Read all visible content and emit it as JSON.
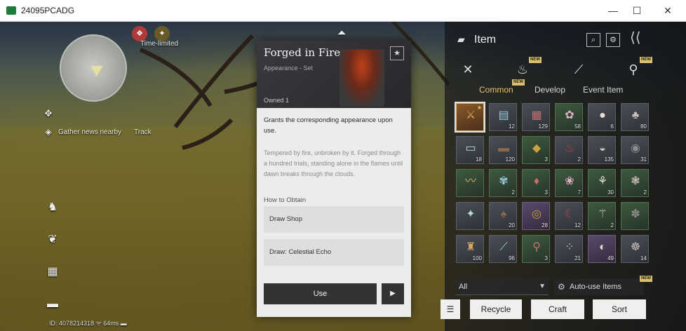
{
  "window": {
    "title": "24095PCADG",
    "min": "—",
    "max": "☐",
    "close": "✕"
  },
  "hud": {
    "time_limited": "Time-limited",
    "gather": "Gather news nearby",
    "track": "Track",
    "status": "ID: 4078214318  ᯤ 64ms ▬"
  },
  "card": {
    "title": "Forged in Fire",
    "subtitle": "Appearance - Set",
    "fav_icon": "star-icon",
    "owned": "Owned 1",
    "description": "Grants the corresponding appearance upon use.",
    "flavor": "Tempered by fire, unbroken by it. Forged through a hundred trials, standing alone in the flames until dawn breaks through the clouds.",
    "how_to_obtain": "How to Obtain",
    "obtain": [
      "Draw Shop",
      "Draw: Celestial Echo"
    ],
    "use": "Use",
    "next": "▶"
  },
  "inventory": {
    "title": "Item",
    "new_tag": "NEW",
    "tabs": [
      "Common",
      "Develop",
      "Event Item"
    ],
    "active_tab": "Common",
    "filter_all": "All",
    "auto_use": "Auto-use Items",
    "buttons": {
      "recycle": "Recycle",
      "craft": "Craft",
      "sort": "Sort"
    },
    "items": [
      {
        "icon": "⚔",
        "count": "",
        "rarity": "orange"
      },
      {
        "icon": "▤",
        "count": "12",
        "rarity": "normal"
      },
      {
        "icon": "▦",
        "count": "129",
        "rarity": "normal"
      },
      {
        "icon": "✿",
        "count": "58",
        "rarity": "green"
      },
      {
        "icon": "●",
        "count": "6",
        "rarity": "normal"
      },
      {
        "icon": "♣",
        "count": "80",
        "rarity": "normal"
      },
      {
        "icon": "▭",
        "count": "18",
        "rarity": "normal"
      },
      {
        "icon": "▬",
        "count": "120",
        "rarity": "normal"
      },
      {
        "icon": "◆",
        "count": "3",
        "rarity": "green"
      },
      {
        "icon": "♨",
        "count": "2",
        "rarity": "normal"
      },
      {
        "icon": "◒",
        "count": "135",
        "rarity": "normal"
      },
      {
        "icon": "◉",
        "count": "31",
        "rarity": "normal"
      },
      {
        "icon": "〰",
        "count": "",
        "rarity": "green"
      },
      {
        "icon": "✾",
        "count": "2",
        "rarity": "green"
      },
      {
        "icon": "♦",
        "count": "3",
        "rarity": "green"
      },
      {
        "icon": "❀",
        "count": "7",
        "rarity": "green"
      },
      {
        "icon": "⚘",
        "count": "30",
        "rarity": "green"
      },
      {
        "icon": "❃",
        "count": "2",
        "rarity": "green"
      },
      {
        "icon": "✦",
        "count": "",
        "rarity": "normal"
      },
      {
        "icon": "♠",
        "count": "20",
        "rarity": "normal"
      },
      {
        "icon": "◎",
        "count": "28",
        "rarity": "purple"
      },
      {
        "icon": "☾",
        "count": "12",
        "rarity": "normal"
      },
      {
        "icon": "⚚",
        "count": "2",
        "rarity": "green"
      },
      {
        "icon": "✽",
        "count": "",
        "rarity": "green"
      },
      {
        "icon": "♜",
        "count": "100",
        "rarity": "normal"
      },
      {
        "icon": "⟋",
        "count": "96",
        "rarity": "normal"
      },
      {
        "icon": "⚲",
        "count": "3",
        "rarity": "green"
      },
      {
        "icon": "⁘",
        "count": "21",
        "rarity": "normal"
      },
      {
        "icon": "◐",
        "count": "49",
        "rarity": "purple"
      },
      {
        "icon": "☸",
        "count": "14",
        "rarity": "normal"
      }
    ]
  }
}
